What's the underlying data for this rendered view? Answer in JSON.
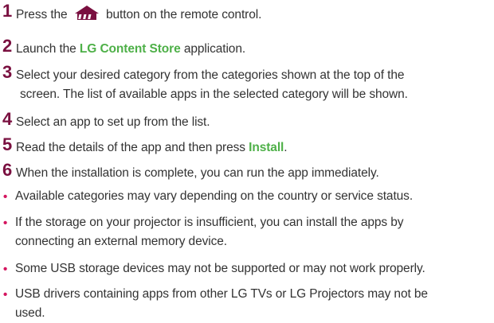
{
  "steps": [
    {
      "number": "1",
      "text_before": "Press the",
      "icon": "home-icon",
      "text_after": "button on the remote control."
    },
    {
      "number": "2",
      "text_before": "Launch the ",
      "highlight": "LG Content Store",
      "text_after": " application."
    },
    {
      "number": "3",
      "line1": "Select your desired category from the categories shown at the top of the",
      "line2": "screen. The list of available apps in the selected category will be shown."
    },
    {
      "number": "4",
      "text": "Select an app to set up from the list."
    },
    {
      "number": "5",
      "text_before": "Read the details of the app and then press ",
      "highlight": "Install",
      "text_after": "."
    },
    {
      "number": "6",
      "text": "When the installation is complete, you can run the app immediately."
    }
  ],
  "notes": [
    {
      "bullet": "•",
      "text": "Available categories may vary depending on the country or service status."
    },
    {
      "bullet": "•",
      "line1": "If the storage on your projector is insufficient, you can install the apps by",
      "line2": "connecting an external memory device."
    },
    {
      "bullet": "•",
      "text": "Some USB storage devices may not be supported or may not work properly."
    },
    {
      "bullet": "•",
      "line1": "USB drivers containing apps from other LG TVs or LG Projectors may not be",
      "line2": "used."
    }
  ],
  "colors": {
    "step_number": "#7a1040",
    "highlight": "#4eb048",
    "bullet": "#d4155f",
    "text": "#333333"
  }
}
